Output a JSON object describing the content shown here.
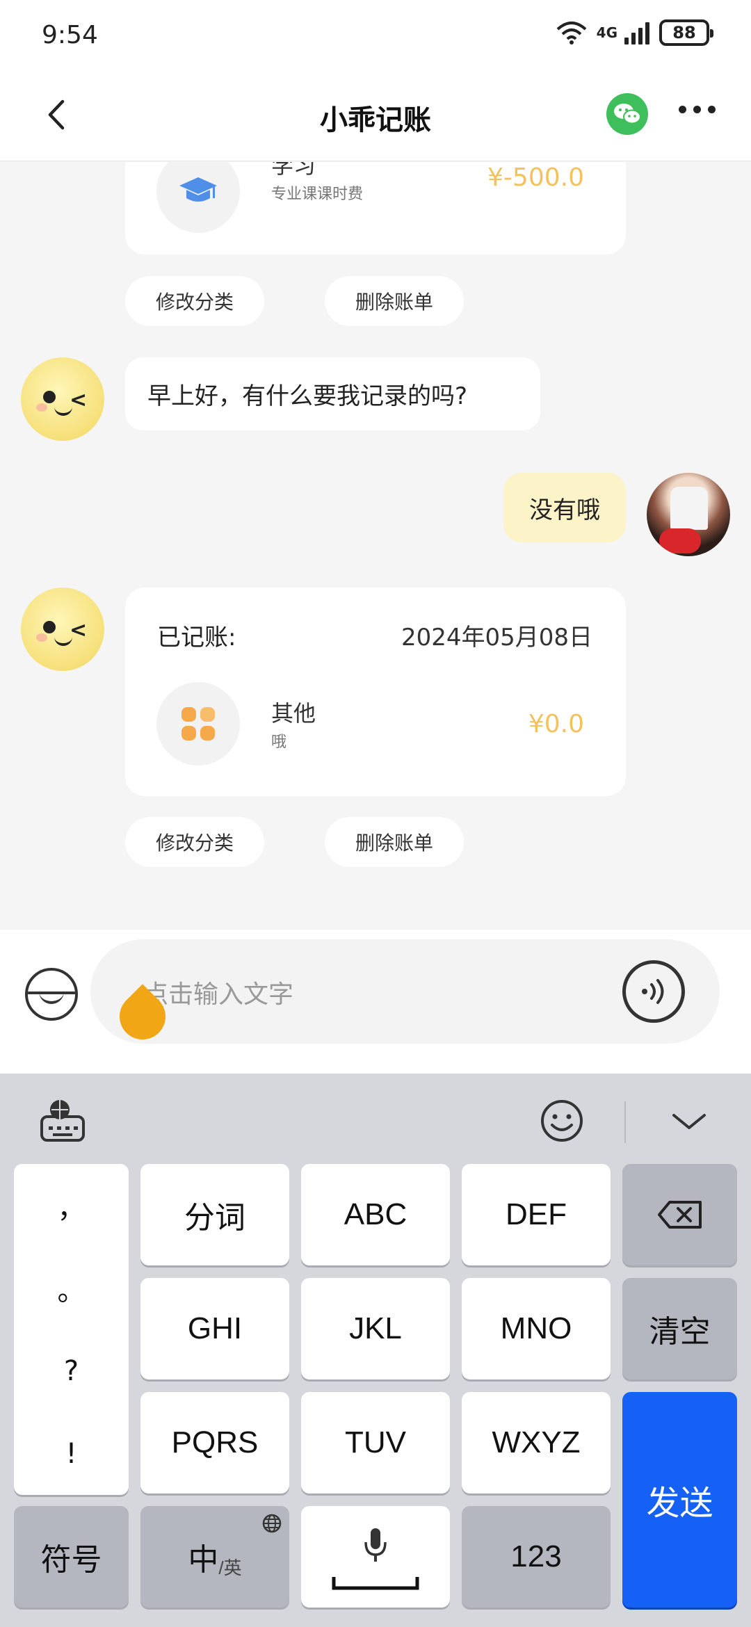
{
  "status_bar": {
    "time": "9:54",
    "network": "4G",
    "battery": "88"
  },
  "header": {
    "title": "小乖记账"
  },
  "chat": {
    "record1": {
      "category": "学习",
      "note": "专业课课时费",
      "amount": "¥-500.0"
    },
    "actions1": {
      "modify": "修改分类",
      "delete": "删除账单"
    },
    "bot_message": "早上好，有什么要我记录的吗?",
    "user_message": "没有哦",
    "record2": {
      "heading": "已记账:",
      "date": "2024年05月08日",
      "category": "其他",
      "note": "哦",
      "amount": "¥0.0"
    },
    "actions2": {
      "modify": "修改分类",
      "delete": "删除账单"
    }
  },
  "input": {
    "placeholder": "点击输入文字"
  },
  "keyboard": {
    "punctuation": [
      "，",
      "。",
      "?",
      "!"
    ],
    "row1": [
      "分词",
      "ABC",
      "DEF"
    ],
    "row2": [
      "GHI",
      "JKL",
      "MNO"
    ],
    "row3": [
      "PQRS",
      "TUV",
      "WXYZ"
    ],
    "symbols": "符号",
    "chinese": "中",
    "english_small": "/英",
    "numbers": "123",
    "clear": "清空",
    "send": "发送"
  },
  "colors": {
    "amount": "#f3c25f",
    "send": "#1560f5",
    "wechat": "#3fbf5b",
    "cursor": "#f0a615"
  }
}
